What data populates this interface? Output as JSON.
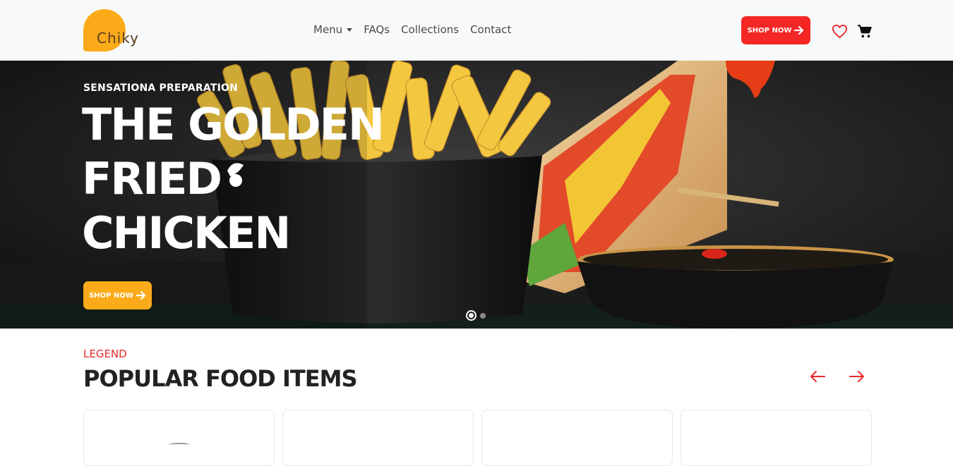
{
  "brand": {
    "name": "Chiky",
    "color": "#fbab1a"
  },
  "nav": {
    "items": [
      "Menu",
      "FAQs",
      "Collections",
      "Contact"
    ]
  },
  "header": {
    "shop_label": "SHOP NOW",
    "accent": "#f42626"
  },
  "hero": {
    "eyebrow": "SENSATIONA PREPARATION",
    "lines": [
      "THE GOLDEN",
      "FRIED",
      "CHICKEN"
    ],
    "shop_label": "SHOP NOW",
    "slides": 2,
    "active_slide": 1
  },
  "section": {
    "eyebrow": "LEGEND",
    "title": "POPULAR FOOD ITEMS",
    "cards": 4
  },
  "icons": [
    "heart-icon",
    "cart-icon",
    "arrow-right-icon",
    "arrow-left-icon"
  ]
}
